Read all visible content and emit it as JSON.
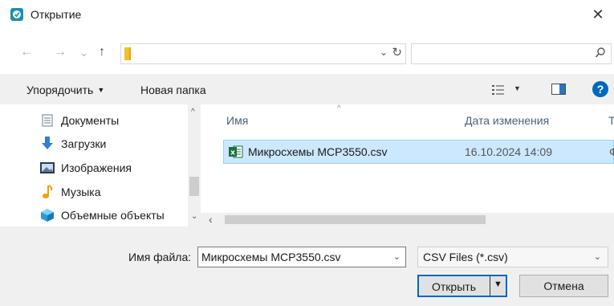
{
  "window": {
    "title": "Открытие",
    "close_glyph": "✕"
  },
  "address": {
    "back": "←",
    "forward": "→",
    "recent": "⌄",
    "up": "↑",
    "dropdown": "⌄",
    "refresh": "↻",
    "search_placeholder": ""
  },
  "toolbar": {
    "organize": "Упорядочить",
    "new_folder": "Новая папка",
    "help": "?"
  },
  "nav": {
    "items": [
      {
        "label": "Документы",
        "icon": "documents-icon"
      },
      {
        "label": "Загрузки",
        "icon": "downloads-icon"
      },
      {
        "label": "Изображения",
        "icon": "pictures-icon"
      },
      {
        "label": "Музыка",
        "icon": "music-icon"
      },
      {
        "label": "Объемные объекты",
        "icon": "3d-objects-icon"
      }
    ]
  },
  "files": {
    "columns": {
      "name": "Имя",
      "date": "Дата изменения",
      "type": "Т"
    },
    "rows": [
      {
        "name": "Микросхемы MCP3550.csv",
        "date": "16.10.2024 14:09",
        "type": "Ф"
      }
    ]
  },
  "bottom": {
    "filename_label": "Имя файла:",
    "filename_value": "Микросхемы MCP3550.csv",
    "filter_value": "CSV Files (*.csv)",
    "open": "Открыть",
    "cancel": "Отмена"
  },
  "colors": {
    "accent": "#0067c0",
    "selection": "#cce8ff",
    "selection_border": "#99d1ff",
    "excel_green": "#1d6f42",
    "folder_yellow": "#f2c028"
  }
}
